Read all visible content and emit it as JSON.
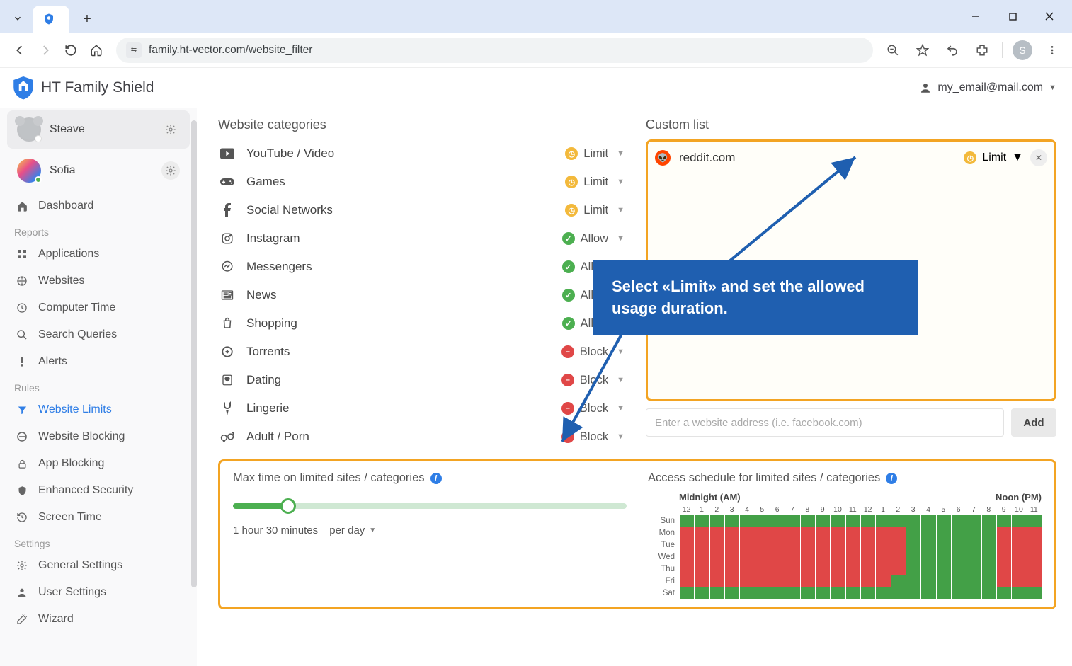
{
  "browser": {
    "url": "family.ht-vector.com/website_filter",
    "avatar_letter": "S"
  },
  "app": {
    "brand": "HT Family Shield",
    "account_email": "my_email@mail.com"
  },
  "sidebar": {
    "users": [
      {
        "name": "Steave",
        "active": true,
        "avatar": "koala"
      },
      {
        "name": "Sofia",
        "active": false,
        "avatar": "sofia"
      }
    ],
    "dashboard_label": "Dashboard",
    "sections": [
      {
        "title": "Reports",
        "items": [
          {
            "icon": "apps",
            "label": "Applications"
          },
          {
            "icon": "globe",
            "label": "Websites"
          },
          {
            "icon": "clock",
            "label": "Computer Time"
          },
          {
            "icon": "search",
            "label": "Search Queries"
          },
          {
            "icon": "alert",
            "label": "Alerts"
          }
        ]
      },
      {
        "title": "Rules",
        "items": [
          {
            "icon": "filter",
            "label": "Website Limits",
            "selected": true
          },
          {
            "icon": "block",
            "label": "Website Blocking"
          },
          {
            "icon": "lock",
            "label": "App Blocking"
          },
          {
            "icon": "shield",
            "label": "Enhanced Security"
          },
          {
            "icon": "history",
            "label": "Screen Time"
          }
        ]
      },
      {
        "title": "Settings",
        "items": [
          {
            "icon": "gear",
            "label": "General Settings"
          },
          {
            "icon": "user",
            "label": "User Settings"
          },
          {
            "icon": "wand",
            "label": "Wizard"
          }
        ]
      }
    ]
  },
  "categories": {
    "title": "Website categories",
    "items": [
      {
        "icon": "video",
        "name": "YouTube / Video",
        "status": "Limit"
      },
      {
        "icon": "game",
        "name": "Games",
        "status": "Limit"
      },
      {
        "icon": "facebook",
        "name": "Social Networks",
        "status": "Limit"
      },
      {
        "icon": "instagram",
        "name": "Instagram",
        "status": "Allow"
      },
      {
        "icon": "messenger",
        "name": "Messengers",
        "status": "Allow"
      },
      {
        "icon": "news",
        "name": "News",
        "status": "Allow"
      },
      {
        "icon": "shopping",
        "name": "Shopping",
        "status": "Allow"
      },
      {
        "icon": "torrent",
        "name": "Torrents",
        "status": "Block"
      },
      {
        "icon": "dating",
        "name": "Dating",
        "status": "Block"
      },
      {
        "icon": "lingerie",
        "name": "Lingerie",
        "status": "Block"
      },
      {
        "icon": "adult",
        "name": "Adult / Porn",
        "status": "Block"
      }
    ]
  },
  "custom_list": {
    "title": "Custom list",
    "entries": [
      {
        "site": "reddit.com",
        "status": "Limit"
      }
    ],
    "input_placeholder": "Enter a website address (i.e. facebook.com)",
    "add_label": "Add"
  },
  "max_time": {
    "title": "Max time on limited sites / categories",
    "value_label": "1 hour 30 minutes",
    "period_label": "per day"
  },
  "schedule": {
    "title": "Access schedule for limited sites / categories",
    "header_left": "Midnight (AM)",
    "header_right": "Noon (PM)",
    "hours": [
      "12",
      "1",
      "2",
      "3",
      "4",
      "5",
      "6",
      "7",
      "8",
      "9",
      "10",
      "11",
      "12",
      "1",
      "2",
      "3",
      "4",
      "5",
      "6",
      "7",
      "8",
      "9",
      "10",
      "11",
      "12"
    ],
    "days": [
      "Sun",
      "Mon",
      "Tue",
      "Wed",
      "Thu",
      "Fri",
      "Sat"
    ],
    "grid": [
      "GGGGGGGGGGGGGGGGGGGGGGGG",
      "RRRRRRRRRRRRRRRGGGGGGRRR",
      "RRRRRRRRRRRRRRRGGGGGGRRR",
      "RRRRRRRRRRRRRRRGGGGGGRRR",
      "RRRRRRRRRRRRRRRGGGGGGRRR",
      "RRRRRRRRRRRRRRGGGGGGGRRR",
      "GGGGGGGGGGGGGGGGGGGGGGGG"
    ]
  },
  "callout": {
    "text": "Select «Limit» and set the allowed usage duration."
  }
}
